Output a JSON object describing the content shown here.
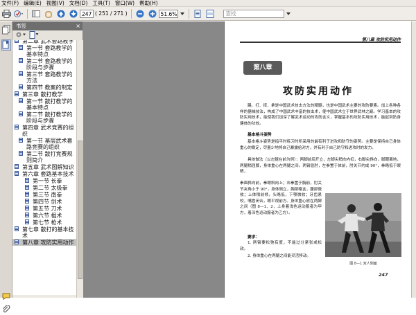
{
  "menu": [
    "文件(F)",
    "编辑(E)",
    "视图(V)",
    "文档(D)",
    "工具(T)",
    "窗口(W)",
    "帮助(H)"
  ],
  "toolbar": {
    "page_current": "247",
    "page_of": "( 251 / 271 )",
    "zoom": "51.6%",
    "search_placeholder": "查找"
  },
  "panel": {
    "title": "书签",
    "close": "×"
  },
  "bookmarks": [
    {
      "label": "第二章 武术套路教学",
      "level": 0
    },
    {
      "label": "第一节 套路教学的基本特点",
      "level": 1
    },
    {
      "label": "第二节 套路教学的阶段与步骤",
      "level": 1
    },
    {
      "label": "第三节 套路教学的方法",
      "level": 1
    },
    {
      "label": "第四节 教案的制定",
      "level": 1
    },
    {
      "label": "第三章 散打教学",
      "level": 0
    },
    {
      "label": "第一节 散打教学的基本特点",
      "level": 1
    },
    {
      "label": "第二节 散打教学的阶段与步骤",
      "level": 1
    },
    {
      "label": "第四章 武术竞赛的组织",
      "level": 0
    },
    {
      "label": "第一节 基层武术套路竞赛的组织",
      "level": 1
    },
    {
      "label": "第二节 散打竞赛规则简介",
      "level": 1
    },
    {
      "label": "第五章 武术图解知识",
      "level": 0
    },
    {
      "label": "第六章 套路基本技术",
      "level": 0
    },
    {
      "label": "第一节 长拳",
      "level": 2
    },
    {
      "label": "第二节 太极拳",
      "level": 2
    },
    {
      "label": "第三节 南拳",
      "level": 2
    },
    {
      "label": "第四节 剑术",
      "level": 2
    },
    {
      "label": "第五节 刀术",
      "level": 2
    },
    {
      "label": "第六节 棍术",
      "level": 2
    },
    {
      "label": "第七节 枪术",
      "level": 2
    },
    {
      "label": "第七章 散打的基本技术",
      "level": 0
    },
    {
      "label": "第八章 攻防实用动作",
      "level": 0,
      "active": true
    }
  ],
  "document": {
    "running_head": "第八章  攻防实用动作",
    "chapter_badge": "第八章",
    "chapter_title": "攻防实用动作",
    "intro": "踢、打、摔、拿是中国武术技击方法的精髓，也是中国武术主要的攻防要素。加上各种各样的器械技法，构成了中国武术丰富的技击术，使中国武术立于世界武林之巅。学习基本的攻防实用技术，能使我们加深了解武术运动的攻防含义，掌握基本的攻防实用技术，能起到防身健体的功效。",
    "subhead": "基本格斗姿势",
    "para2": "基本格斗姿势是指平时练习时所采用的最有利于进攻和防守的姿势。主要是保持自己身体重心的稳定，尽量少地将自己暴露给对方，并有利于自己防守和进攻时的发力。",
    "para3_wide": "具体做法（以左腿在前为例）：两脚前后开立，左脚尖稍向内扣，右脚尖斜向，脚跟离地，两腿稍屈膝，身体重心在两腿之间。两臂屈肘，左拳置于体前，肘关节约成 90°，拳略低于眼睛，",
    "para3_narrow": "拳面斜向前，拳眼斜向上；右拳置于胸前，肘关节夹角小于 90°，身体侧立，胸部略含，腹部微收；上体稍前倾，头略低，下颚微收；牙齿紧咬，嘴唇闭合，眼平视前方。身体重心放在两脚之间（图 8—1、2，上身着浅色运动服者为甲方，着深色运动服者为乙方）。",
    "subhead2": "要求：",
    "req1": "1. 两臂要松弛有度，不能过分紧张或松软。",
    "req2": "2. 身体重心在两腿之间能灵活移动。",
    "caption": "图 8—1  双人侧面",
    "page_number": "247"
  }
}
